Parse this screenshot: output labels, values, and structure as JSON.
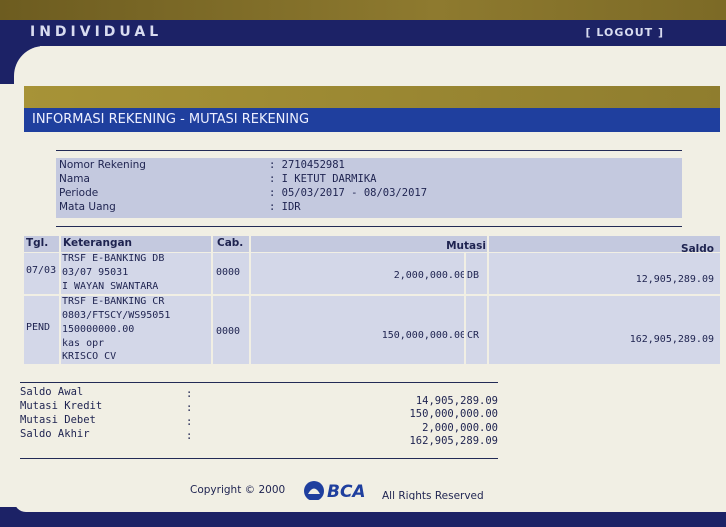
{
  "header": {
    "brand": "INDIVIDUAL",
    "logout": "[ LOGOUT ]"
  },
  "section": {
    "title": "INFORMASI REKENING - MUTASI REKENING"
  },
  "account": {
    "rows": [
      {
        "label": "Nomor Rekening",
        "value": ": 2710452981"
      },
      {
        "label": "Nama",
        "value": ": I KETUT DARMIKA"
      },
      {
        "label": "Periode",
        "value": ": 05/03/2017 - 08/03/2017"
      },
      {
        "label": "Mata Uang",
        "value": ": IDR"
      }
    ]
  },
  "table": {
    "headers": {
      "tgl": "Tgl.",
      "keterangan": "Keterangan",
      "cab": "Cab.",
      "mutasi": "Mutasi",
      "saldo": "Saldo"
    },
    "rows": [
      {
        "tgl": "07/03",
        "keterangan": [
          "TRSF E-BANKING DB",
          "03/07 95031",
          "I WAYAN SWANTARA"
        ],
        "cab": "0000",
        "mutasi": "2,000,000.00",
        "type": "DB",
        "saldo": "12,905,289.09"
      },
      {
        "tgl": "PEND",
        "keterangan": [
          "TRSF E-BANKING CR",
          "0803/FTSCY/WS95051",
          "150000000.00",
          "kas opr",
          "KRISCO CV"
        ],
        "cab": "0000",
        "mutasi": "150,000,000.00",
        "type": "CR",
        "saldo": "162,905,289.09"
      }
    ]
  },
  "summary": [
    {
      "label": "Saldo Awal",
      "colon": ":",
      "value": "14,905,289.09"
    },
    {
      "label": "Mutasi Kredit",
      "colon": ":",
      "value": "150,000,000.00"
    },
    {
      "label": "Mutasi Debet",
      "colon": ":",
      "value": "2,000,000.00"
    },
    {
      "label": "Saldo Akhir",
      "colon": ":",
      "value": "162,905,289.09"
    }
  ],
  "footer": {
    "copyright": "Copyright © 2000",
    "logo_text": "BCA",
    "rights": "All Rights Reserved"
  },
  "colors": {
    "navy": "#1c2266",
    "gold": "#8e7a2f",
    "title_blue": "#1f3f9e",
    "panel": "#c4c9df"
  }
}
